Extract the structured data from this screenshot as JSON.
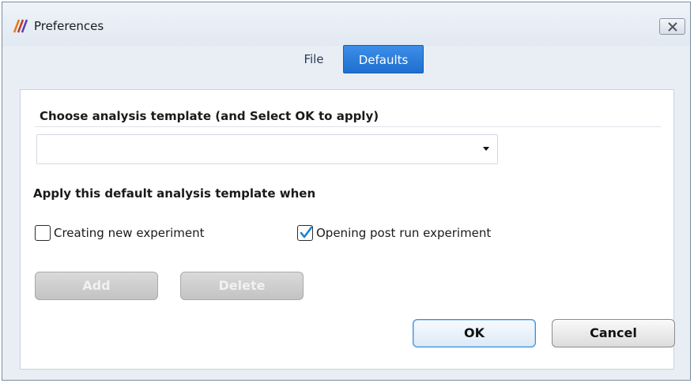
{
  "window": {
    "title": "Preferences"
  },
  "tabs": [
    {
      "label": "File",
      "active": false
    },
    {
      "label": "Defaults",
      "active": true
    }
  ],
  "panel": {
    "heading": "Choose analysis template (and Select OK to apply)",
    "template_select": {
      "value": ""
    },
    "apply_heading": "Apply this default analysis template when",
    "checkboxes": [
      {
        "label": "Creating new experiment",
        "checked": false
      },
      {
        "label": "Opening post run experiment",
        "checked": true
      }
    ]
  },
  "buttons": {
    "add": "Add",
    "delete": "Delete",
    "ok": "OK",
    "cancel": "Cancel"
  },
  "colors": {
    "accent": "#2a7ad9",
    "check": "#1f7fd6"
  },
  "icons": {
    "app": "app-logo-icon",
    "close": "close-icon",
    "dropdown": "chevron-down-icon",
    "check": "checkmark-icon"
  }
}
